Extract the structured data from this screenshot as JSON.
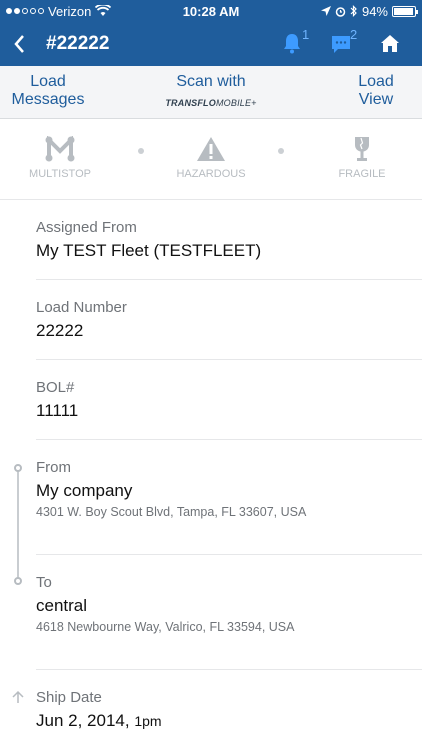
{
  "status_bar": {
    "carrier": "Verizon",
    "time": "10:28 AM",
    "battery": "94%",
    "battery_level": 0.94
  },
  "nav": {
    "title": "#22222",
    "notifications_count": "1",
    "messages_count": "2",
    "accent_color": "#1f5d9c"
  },
  "actions": {
    "load_messages": "Load Messages",
    "scan_with": "Scan with",
    "brand": "TRANSFLO",
    "brand_suffix": "MOBILE+",
    "load_view": "Load View"
  },
  "attributes": [
    {
      "label": "MULTISTOP",
      "icon": "multistop-icon"
    },
    {
      "label": "HAZARDOUS",
      "icon": "warning-icon"
    },
    {
      "label": "FRAGILE",
      "icon": "glass-icon"
    }
  ],
  "details": {
    "assigned_from": {
      "label": "Assigned From",
      "value": "My TEST Fleet (TESTFLEET)"
    },
    "load_number": {
      "label": "Load Number",
      "value": "22222"
    },
    "bol": {
      "label": "BOL#",
      "value": "11111"
    },
    "from": {
      "label": "From",
      "name": "My company",
      "address": "4301 W. Boy Scout Blvd, Tampa, FL 33607, USA"
    },
    "to": {
      "label": "To",
      "name": "central",
      "address": "4618 Newbourne Way, Valrico, FL 33594, USA"
    },
    "ship_date": {
      "label": "Ship Date",
      "date": "Jun 2, 2014,",
      "time": "1pm"
    }
  }
}
